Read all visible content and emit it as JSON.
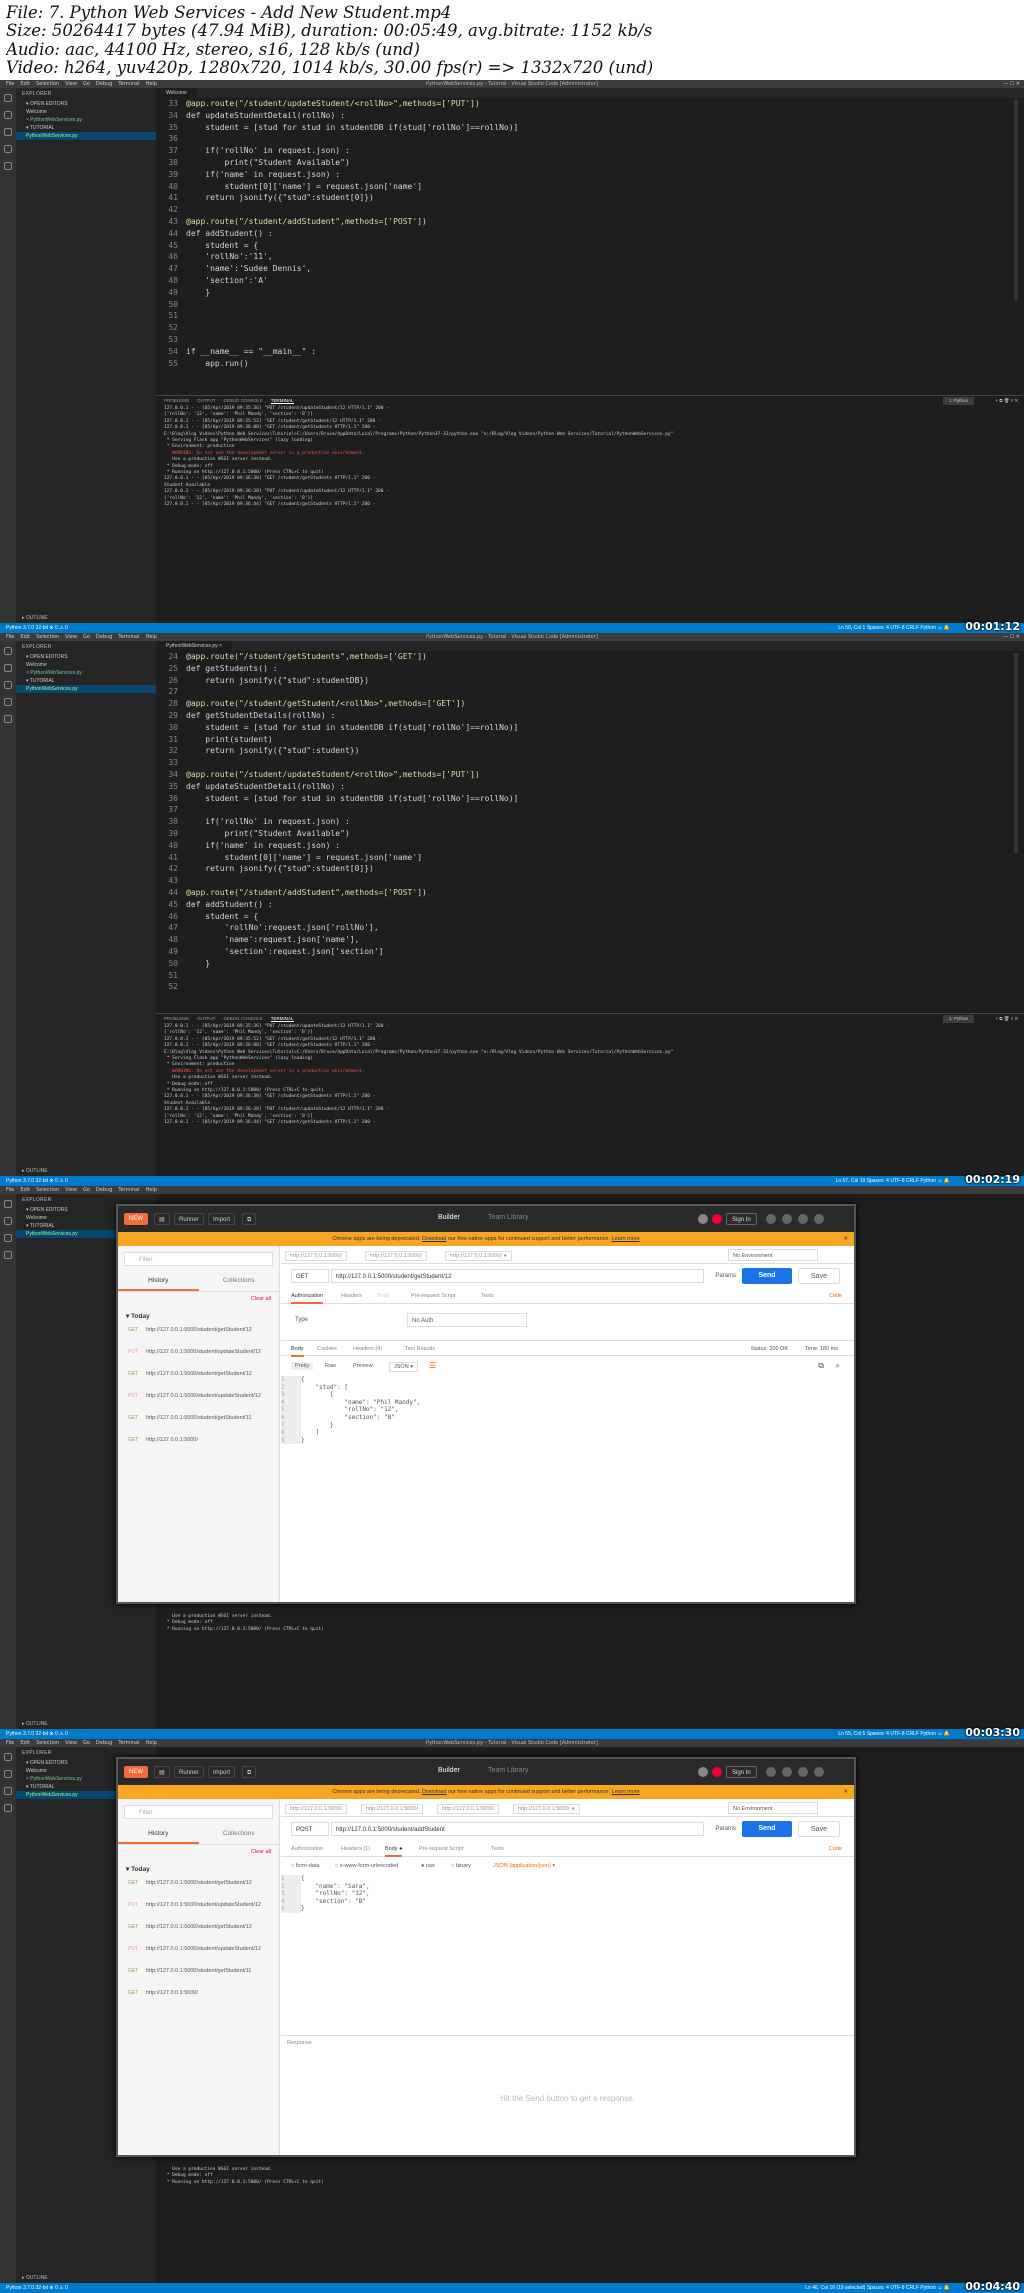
{
  "meta": {
    "lines": [
      "File: 7. Python Web Services - Add New Student.mp4",
      "Size: 50264417 bytes (47.94 MiB), duration: 00:05:49, avg.bitrate: 1152 kb/s",
      "Audio: aac, 44100 Hz, stereo, s16, 128 kb/s (und)",
      "Video: h264, yuv420p, 1280x720, 1014 kb/s, 30.00 fps(r) => 1332x720 (und)"
    ]
  },
  "vscode": {
    "menu": [
      "File",
      "Edit",
      "Selection",
      "View",
      "Go",
      "Debug",
      "Terminal",
      "Help"
    ],
    "window_title": "PythonWebServices.py - Tutorial - Visual Studio Code [Administrator]",
    "window_buttons": "—  ☐  ✕",
    "explorer_header": "EXPLORER",
    "open_editors": "▾ OPEN EDITORS",
    "open_file": "Welcome",
    "open_file2": "× PythonWebServices.py",
    "tutorial": "▾ TUTORIAL",
    "tutorial_file": "PythonWebServices.py",
    "outline": "▸ OUTLINE",
    "tab_welcome": "Welcome",
    "tab_file": "PythonWebServices.py ×",
    "panel_tabs": [
      "PROBLEMS",
      "OUTPUT",
      "DEBUG CONSOLE",
      "TERMINAL"
    ],
    "panel_select": "1: Python",
    "panel_icons": "+  ⧉  🗑  ˄  ✕",
    "status_left": "Python 3.7.0 32-bit   ⊗ 0  ⚠ 0",
    "status_right_1": "Ln 50, Col 1   Spaces: 4   UTF-8   CRLF   Python   ☺  🔔",
    "status_right_2": "Ln 57, Col 19   Spaces: 4   UTF-8   CRLF   Python   ☺  🔔",
    "status_right_3": "Ln 55, Col 5   Spaces: 4   UTF-8   CRLF   Python   ☺  🔔",
    "status_right_4": "Ln 46, Col 16 (19 selected)   Spaces: 4   UTF-8   CRLF   Python   ☺  🔔"
  },
  "frame1": {
    "timestamp": "00:01:12",
    "code": [
      [
        "33",
        "@app.route(\"/student/updateStudent/<rollNo>\",methods=['PUT'])"
      ],
      [
        "34",
        "def updateStudentDetail(rollNo) :"
      ],
      [
        "35",
        "    student = [stud for stud in studentDB if(stud['rollNo']==rollNo)]"
      ],
      [
        "36",
        ""
      ],
      [
        "37",
        "    if('rollNo' in request.json) :"
      ],
      [
        "38",
        "        print(\"Student Available\")"
      ],
      [
        "39",
        "    if('name' in request.json) :"
      ],
      [
        "40",
        "        student[0]['name'] = request.json['name']"
      ],
      [
        "41",
        "    return jsonify({\"stud\":student[0]})"
      ],
      [
        "42",
        ""
      ],
      [
        "43",
        "@app.route(\"/student/addStudent\",methods=['POST'])"
      ],
      [
        "44",
        "def addStudent() :"
      ],
      [
        "45",
        "    student = {"
      ],
      [
        "46",
        "    'rollNo':'11',"
      ],
      [
        "47",
        "    'name':'Sudee Dennis',"
      ],
      [
        "48",
        "    'section':'A'"
      ],
      [
        "49",
        "    }"
      ],
      [
        "50",
        ""
      ],
      [
        "51",
        ""
      ],
      [
        "52",
        ""
      ],
      [
        "53",
        ""
      ],
      [
        "54",
        "if __name__ == \"__main__\" :"
      ],
      [
        "55",
        "    app.run()"
      ]
    ],
    "terminal": [
      "127.0.0.1 - - [05/Apr/2019 09:35:36] \"PUT /student/updateStudent/12 HTTP/1.1\" 200 -",
      "{'rollNo': '12', 'name': 'Phil Mandy', 'section': 'B'}]",
      "127.0.0.1 - - [05/Apr/2019 09:35:52] \"GET /student/getStudent/12 HTTP/1.1\" 200 -",
      "127.0.0.1 - - [05/Apr/2019 09:36:00] \"GET /student/getStudents HTTP/1.1\" 200 -",
      "",
      "E:\\Blog\\Vlog Videos\\Python Web Services\\Tutorial>C:/Users/Bruce/AppData/Local/Programs/Python/Python37-32/python.exe \"e:/Blog/Vlog Videos/Python Web Services/Tutorial/PythonWebServices.py\"",
      " * Serving Flask app \"PythonWebServices\" (lazy loading)",
      " * Environment: production",
      "   WARNING: Do not use the development server in a production environment.",
      "   Use a production WSGI server instead.",
      " * Debug mode: off",
      " * Running on http://127.0.0.1:5000/ (Press CTRL+C to quit)",
      "127.0.0.1 - - [05/Apr/2019 09:36:38] \"GET /student/getStudents HTTP/1.1\" 200 -",
      "Student Available",
      "127.0.0.1 - - [05/Apr/2019 09:36:38] \"PUT /student/updateStudent/12 HTTP/1.1\" 200 -",
      "{'rollNo': '12', 'name': 'Phil Mandy', 'section': 'B'}]",
      "127.0.0.1 - - [05/Apr/2019 09:36:44] \"GET /student/getStudents HTTP/1.1\" 200 -"
    ]
  },
  "frame2": {
    "timestamp": "00:02:19",
    "code": [
      [
        "24",
        "@app.route(\"/student/getStudents\",methods=['GET'])"
      ],
      [
        "25",
        "def getStudents() :"
      ],
      [
        "26",
        "    return jsonify({\"stud\":studentDB})"
      ],
      [
        "27",
        ""
      ],
      [
        "28",
        "@app.route(\"/student/getStudent/<rollNo>\",methods=['GET'])"
      ],
      [
        "29",
        "def getStudentDetails(rollNo) :"
      ],
      [
        "30",
        "    student = [stud for stud in studentDB if(stud['rollNo']==rollNo)]"
      ],
      [
        "31",
        "    print(student)"
      ],
      [
        "32",
        "    return jsonify({\"stud\":student})"
      ],
      [
        "33",
        ""
      ],
      [
        "34",
        "@app.route(\"/student/updateStudent/<rollNo>\",methods=['PUT'])"
      ],
      [
        "35",
        "def updateStudentDetail(rollNo) :"
      ],
      [
        "36",
        "    student = [stud for stud in studentDB if(stud['rollNo']==rollNo)]"
      ],
      [
        "37",
        ""
      ],
      [
        "38",
        "    if('rollNo' in request.json) :"
      ],
      [
        "39",
        "        print(\"Student Available\")"
      ],
      [
        "40",
        "    if('name' in request.json) :"
      ],
      [
        "41",
        "        student[0]['name'] = request.json['name']"
      ],
      [
        "42",
        "    return jsonify({\"stud\":student[0]})"
      ],
      [
        "43",
        ""
      ],
      [
        "44",
        "@app.route(\"/student/addStudent\",methods=['POST'])"
      ],
      [
        "45",
        "def addStudent() :"
      ],
      [
        "46",
        "    student = {"
      ],
      [
        "47",
        "        'rollNo':request.json['rollNo'],"
      ],
      [
        "48",
        "        'name':request.json['name'],"
      ],
      [
        "49",
        "        'section':request.json['section']"
      ],
      [
        "50",
        "    }"
      ],
      [
        "51",
        ""
      ],
      [
        "52",
        ""
      ]
    ],
    "terminal": [
      "127.0.0.1 - - [05/Apr/2019 09:35:36] \"PUT /student/updateStudent/12 HTTP/1.1\" 200 -",
      "{'rollNo': '12', 'name': 'Phil Mandy', 'section': 'B'}]",
      "127.0.0.1 - - [05/Apr/2019 09:35:52] \"GET /student/getStudent/12 HTTP/1.1\" 200 -",
      "127.0.0.1 - - [05/Apr/2019 09:36:00] \"GET /student/getStudents HTTP/1.1\" 200 -",
      "",
      "E:\\Blog\\Vlog Videos\\Python Web Services\\Tutorial>C:/Users/Bruce/AppData/Local/Programs/Python/Python37-32/python.exe \"e:/Blog/Vlog Videos/Python Web Services/Tutorial/PythonWebServices.py\"",
      " * Serving Flask app \"PythonWebServices\" (lazy loading)",
      " * Environment: production",
      "   WARNING: Do not use the development server in a production environment.",
      "   Use a production WSGI server instead.",
      " * Debug mode: off",
      " * Running on http://127.0.0.1:5000/ (Press CTRL+C to quit)",
      "127.0.0.1 - - [05/Apr/2019 09:36:38] \"GET /student/getStudents HTTP/1.1\" 200 -",
      "Student Available",
      "127.0.0.1 - - [05/Apr/2019 09:36:38] \"PUT /student/updateStudent/12 HTTP/1.1\" 200 -",
      "{'rollNo': '12', 'name': 'Phil Mandy', 'section': 'B'}]",
      "127.0.0.1 - - [05/Apr/2019 09:36:44] \"GET /student/getStudents HTTP/1.1\" 200 -"
    ]
  },
  "postman": {
    "new": "NEW",
    "runner": "Runner",
    "import": "Import",
    "builder": "Builder",
    "team_library": "Team Library",
    "sign_in": "Sign In",
    "banner_text": "Chrome apps are being deprecated.",
    "banner_link": "Download",
    "banner_rest": "our free native apps for continued support and better performance.",
    "banner_learn": "Learn more",
    "filter": "Filter",
    "history": "History",
    "collections": "Collections",
    "clear_all": "Clear all",
    "today": "▾ Today",
    "history_items": [
      {
        "method": "GET",
        "url": "http://127.0.0.1:5000/student/getStudent/12"
      },
      {
        "method": "PUT",
        "url": "http://127.0.0.1:5000/student/updateStudent/12"
      },
      {
        "method": "GET",
        "url": "http://127.0.0.1:5000/student/getStudent/12"
      },
      {
        "method": "PUT",
        "url": "http://127.0.0.1:5000/student/updateStudent/12"
      },
      {
        "method": "GET",
        "url": "http://127.0.0.1:5000/student/getStudent/11"
      },
      {
        "method": "GET",
        "url": "http://127.0.0.1:5000/"
      }
    ],
    "no_env": "No Environment",
    "params": "Params",
    "send": "Send",
    "save": "Save",
    "code": "Code",
    "frame3": {
      "timestamp": "00:03:30",
      "req_tabs": [
        "http://127.0.0.1:5000/",
        "http://127.0.0.1:5000/",
        "http://127.0.0.1:5000/ ●"
      ],
      "method": "GET",
      "url": "http://127.0.0.1:5000/student/getStudent/12",
      "subtabs": [
        "Authorization",
        "Headers",
        "Body",
        "Pre-request Script",
        "Tests"
      ],
      "type_label": "Type",
      "type_value": "No Auth",
      "resp_tabs": [
        "Body",
        "Cookies",
        "Headers (4)",
        "Test Results"
      ],
      "status": "Status: 200 OK",
      "time": "Time: 180 ms",
      "view_opts": [
        "Pretty",
        "Raw",
        "Preview",
        "JSON ▾"
      ],
      "body": [
        [
          "1",
          "{"
        ],
        [
          "2",
          "    \"stud\": ["
        ],
        [
          "3",
          "        {"
        ],
        [
          "4",
          "            \"name\": \"Phil Mandy\","
        ],
        [
          "5",
          "            \"rollNo\": \"12\","
        ],
        [
          "6",
          "            \"section\": \"B\""
        ],
        [
          "7",
          "        }"
        ],
        [
          "8",
          "    ]"
        ],
        [
          "9",
          "}"
        ]
      ],
      "terminal": [
        "   Use a production WSGI server instead.",
        " * Debug mode: off",
        " * Running on http://127.0.0.1:5000/ (Press CTRL+C to quit)"
      ]
    },
    "frame4": {
      "timestamp": "00:04:40",
      "req_tabs": [
        "http://127.0.0.1:5000/",
        "http://127.0.0.1:5000/",
        "http://127.0.0.1:5000/",
        "http://127.0.0.1:5000/ ●"
      ],
      "method": "POST",
      "url": "http://127.0.0.1:5000/student/addStudent",
      "subtabs": [
        "Authorization",
        "Headers (1)",
        "Body ●",
        "Pre-request Script",
        "Tests"
      ],
      "body_opts": [
        "form-data",
        "x-www-form-urlencoded",
        "raw",
        "binary",
        "JSON (application/json) ▾"
      ],
      "body": [
        [
          "1",
          "{"
        ],
        [
          "2",
          "    \"name\": \"Sara\","
        ],
        [
          "3",
          "    \"rollNo\": \"32\","
        ],
        [
          "4",
          "    \"section\": \"B\""
        ],
        [
          "5",
          "}"
        ]
      ],
      "response_label": "Response",
      "hint": "Hit the Send button to get a response.",
      "terminal": [
        "   Use a production WSGI server instead.",
        " * Debug mode: off",
        " * Running on http://127.0.0.1:5000/ (Press CTRL+C to quit)"
      ]
    }
  }
}
